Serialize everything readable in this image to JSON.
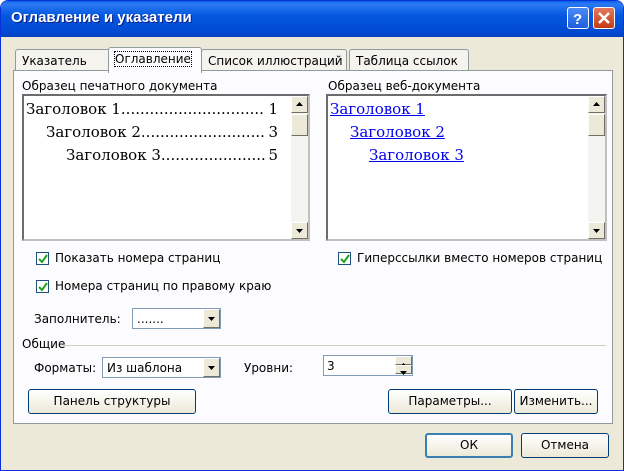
{
  "window": {
    "title": "Оглавление и указатели"
  },
  "tabs": [
    {
      "label": "Указатель"
    },
    {
      "label": "Оглавление"
    },
    {
      "label": "Список иллюстраций"
    },
    {
      "label": "Таблица ссылок"
    }
  ],
  "print_preview": {
    "label": "Образец печатного документа",
    "entries": [
      {
        "text": "Заголовок 1",
        "page": "1"
      },
      {
        "text": "Заголовок 2",
        "page": "3"
      },
      {
        "text": "Заголовок 3",
        "page": "5"
      }
    ]
  },
  "web_preview": {
    "label": "Образец веб-документа",
    "entries": [
      "Заголовок 1",
      "Заголовок 2",
      "Заголовок 3"
    ]
  },
  "options": {
    "show_page_numbers": {
      "label": "Показать номера страниц",
      "checked": true
    },
    "right_align": {
      "label": "Номера страниц по правому краю",
      "checked": true
    },
    "hyperlinks": {
      "label": "Гиперссылки вместо номеров страниц",
      "checked": true
    },
    "filler_label": "Заполнитель:",
    "filler_value": "......."
  },
  "general": {
    "label": "Общие",
    "formats_label": "Форматы:",
    "formats_value": "Из шаблона",
    "levels_label": "Уровни:",
    "levels_value": "3"
  },
  "buttons": {
    "outline": "Панель структуры",
    "params": "Параметры...",
    "modify": "Изменить...",
    "ok": "ОК",
    "cancel": "Отмена"
  },
  "colors": {
    "titlebar": "#0149d2",
    "link": "#0000ee",
    "dialog_bg": "#ece9d8"
  }
}
